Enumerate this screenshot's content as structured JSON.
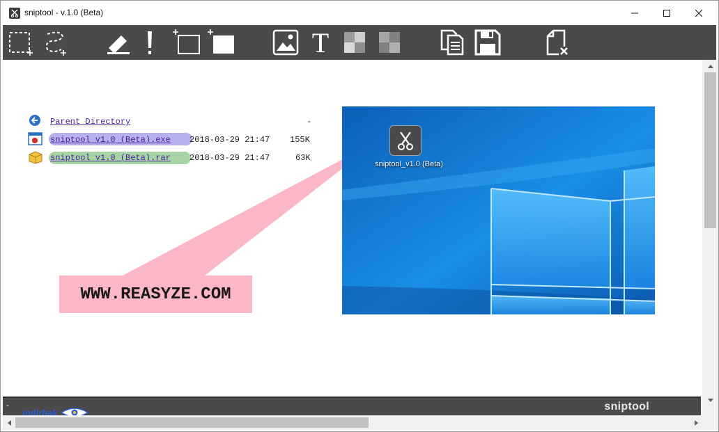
{
  "window": {
    "title": "sniptool - v.1.0 (Beta)",
    "minimize_icon": "minimize-icon",
    "maximize_icon": "maximize-icon",
    "close_icon": "close-icon"
  },
  "toolbar": {
    "tools": [
      {
        "name": "rect-select-add",
        "icon": "rectangle-selection-icon"
      },
      {
        "name": "freeform-select-add",
        "icon": "lasso-selection-icon"
      },
      {
        "name": "highlighter",
        "icon": "highlighter-icon"
      },
      {
        "name": "marker",
        "icon": "exclamation-marker-icon"
      },
      {
        "name": "rectangle-outline",
        "icon": "rectangle-outline-icon"
      },
      {
        "name": "rectangle-filled",
        "icon": "rectangle-filled-icon"
      },
      {
        "name": "image",
        "icon": "image-icon"
      },
      {
        "name": "text",
        "icon": "text-icon",
        "label": "T"
      },
      {
        "name": "pixelate",
        "icon": "pixelate-icon"
      },
      {
        "name": "blur",
        "icon": "blur-icon"
      },
      {
        "name": "copy",
        "icon": "copy-icon"
      },
      {
        "name": "save",
        "icon": "save-icon"
      },
      {
        "name": "close-capture",
        "icon": "close-file-icon"
      }
    ]
  },
  "listing": {
    "parent": {
      "label": "Parent Directory",
      "size": "-"
    },
    "files": [
      {
        "name": "sniptool v1.0 (Beta).exe",
        "date": "2018-03-29 21:47",
        "size": "155K",
        "highlight": "#b8b2ec"
      },
      {
        "name": "sniptool v1.0 (Beta).rar",
        "date": "2018-03-29 21:47",
        "size": "63K",
        "highlight": "#a7d4a5"
      }
    ]
  },
  "callout": {
    "text": "WWW.REASYZE.COM",
    "color": "#fbb7c6"
  },
  "desktop": {
    "icon_label": "sniptool_v1.0 (Beta)"
  },
  "statusbar": {
    "left_text": "-",
    "brand": "sniptool",
    "watermark": "indirbak"
  },
  "colors": {
    "toolbar_bg": "#4a4a4a",
    "accent_link": "#4b1f9a",
    "desktop_blue": "#0f7ad8"
  }
}
